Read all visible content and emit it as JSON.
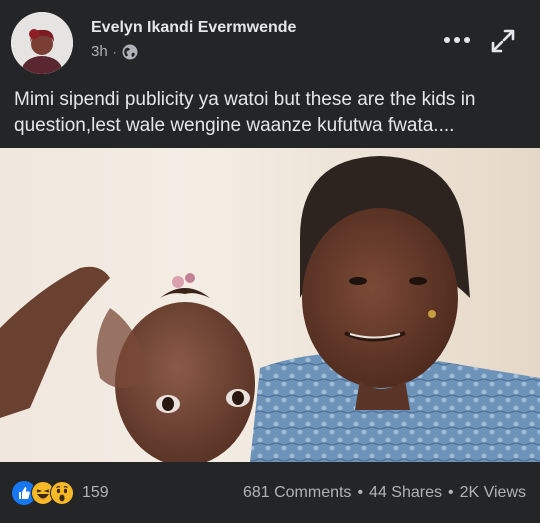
{
  "post": {
    "author": "Evelyn Ikandi Evermwende",
    "time": "3h",
    "separator": "·",
    "privacy_icon": "globe-icon",
    "caption": "Mimi sipendi publicity ya watoi but these are the kids in question,lest wale wengine waanze kufutwa fwata....",
    "menu_icon": "more-horizontal-icon",
    "expand_icon": "expand-icon"
  },
  "footer": {
    "reactions": [
      "like-icon",
      "haha-icon",
      "wow-icon"
    ],
    "reaction_count": "159",
    "comments": "681 Comments",
    "shares": "44 Shares",
    "views": "2K Views",
    "separator": "•"
  },
  "colors": {
    "background": "#242526",
    "text_primary": "#e4e6eb",
    "text_secondary": "#b0b3b8",
    "like_blue": "#1877f2",
    "emoji_yellow": "#f7b928"
  }
}
